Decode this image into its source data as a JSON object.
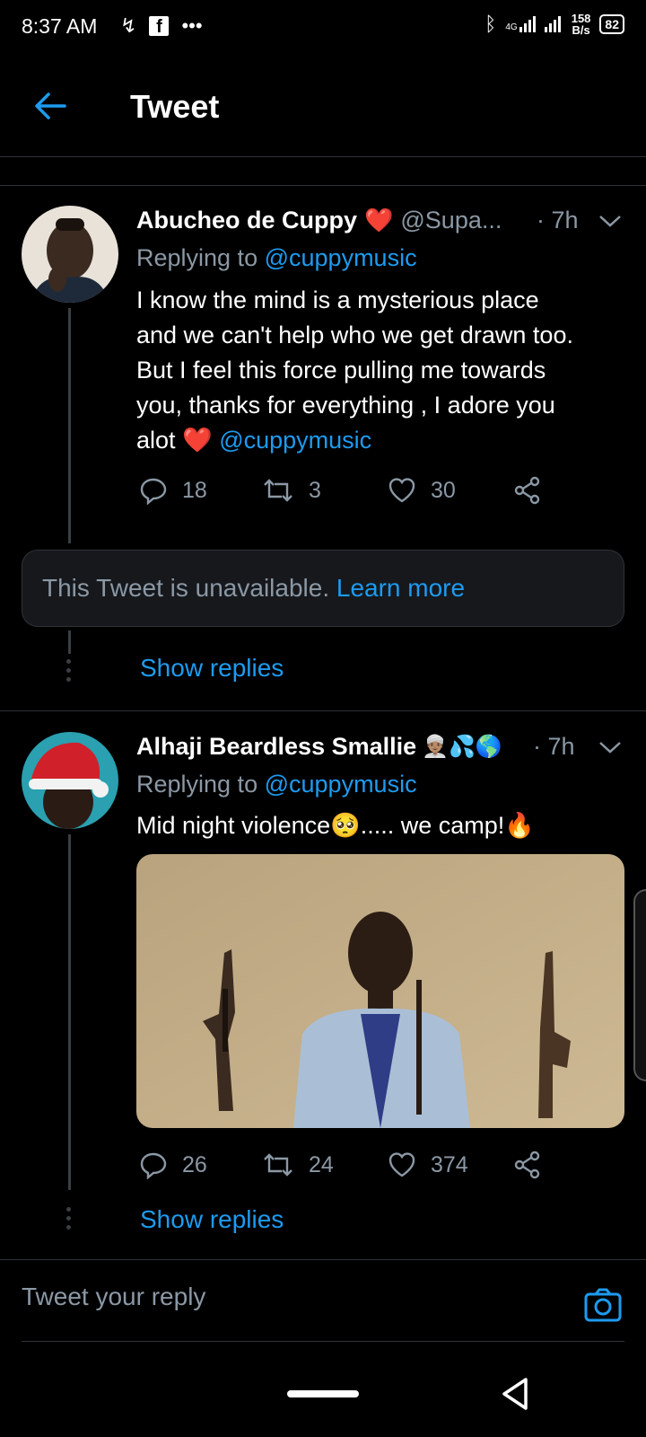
{
  "status_bar": {
    "time": "8:37 AM",
    "network": "4G",
    "speed_value": "158",
    "speed_unit": "B/s",
    "battery": "82"
  },
  "header": {
    "title": "Tweet"
  },
  "tweets": [
    {
      "name": "Abucheo de Cuppy",
      "name_emoji": "❤️",
      "handle": "@Supa...",
      "time": "· 7h",
      "replying_prefix": "Replying to",
      "replying_handle": "@cuppymusic",
      "body_lines": [
        "I know the mind is a mysterious place",
        "and we can't help who we get drawn too.",
        "But I feel this force pulling me towards",
        "you, thanks for everything , I adore you"
      ],
      "body_last_prefix": "alot",
      "body_last_emoji": "❤️",
      "body_last_mention": "@cuppymusic",
      "replies": "18",
      "retweets": "3",
      "likes": "30"
    },
    {
      "name": "Alhaji Beardless Smallie",
      "name_emoji": "👳🏽‍♂️💦🌎",
      "time": "· 7h",
      "replying_prefix": "Replying to",
      "replying_handle": "@cuppymusic",
      "body": "Mid night violence",
      "body_emoji": "🥺",
      "body_tail": "..... we camp!",
      "body_tail_emoji": "🔥",
      "replies": "26",
      "retweets": "24",
      "likes": "374"
    }
  ],
  "unavailable": {
    "text": "This Tweet is unavailable.",
    "link": "Learn more"
  },
  "show_replies": "Show replies",
  "reply_bar": {
    "placeholder": "Tweet your reply"
  },
  "colors": {
    "background": "#000000",
    "accent": "#1d9bf0",
    "muted": "#8b98a5",
    "border": "#2f3336"
  }
}
